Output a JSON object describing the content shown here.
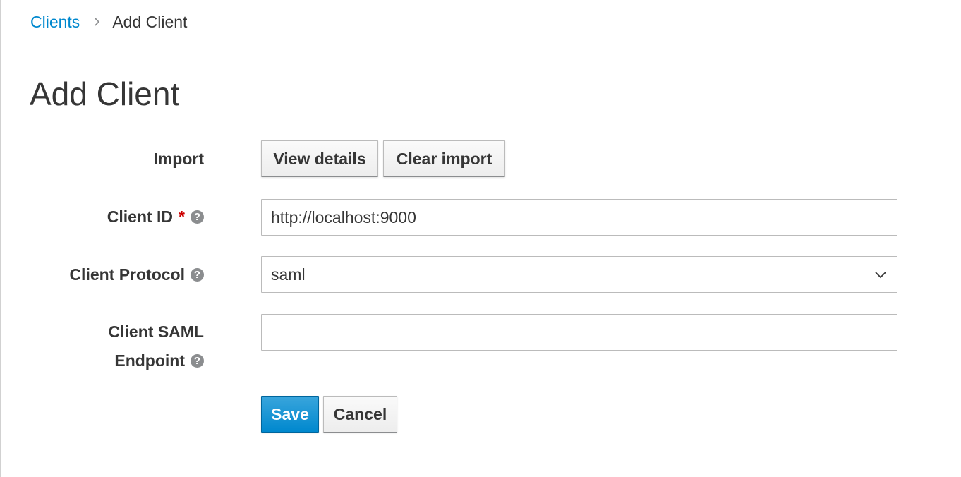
{
  "breadcrumb": {
    "parent": "Clients",
    "current": "Add Client"
  },
  "page": {
    "title": "Add Client"
  },
  "form": {
    "import": {
      "label": "Import",
      "view_details": "View details",
      "clear_import": "Clear import"
    },
    "client_id": {
      "label": "Client ID",
      "required_mark": "*",
      "value": "http://localhost:9000"
    },
    "client_protocol": {
      "label": "Client Protocol",
      "selected": "saml"
    },
    "client_saml_endpoint": {
      "label_line1": "Client SAML",
      "label_line2": "Endpoint",
      "value": ""
    },
    "help_glyph": "?",
    "actions": {
      "save": "Save",
      "cancel": "Cancel"
    }
  },
  "colors": {
    "link": "#0088ce",
    "primary": "#0088ce",
    "required": "#cc0000",
    "text": "#363636",
    "help_icon": "#8b8d8f"
  },
  "icons": {
    "breadcrumb_separator": "chevron-right-icon",
    "help": "help-circle-icon",
    "select_caret": "chevron-down-icon"
  }
}
